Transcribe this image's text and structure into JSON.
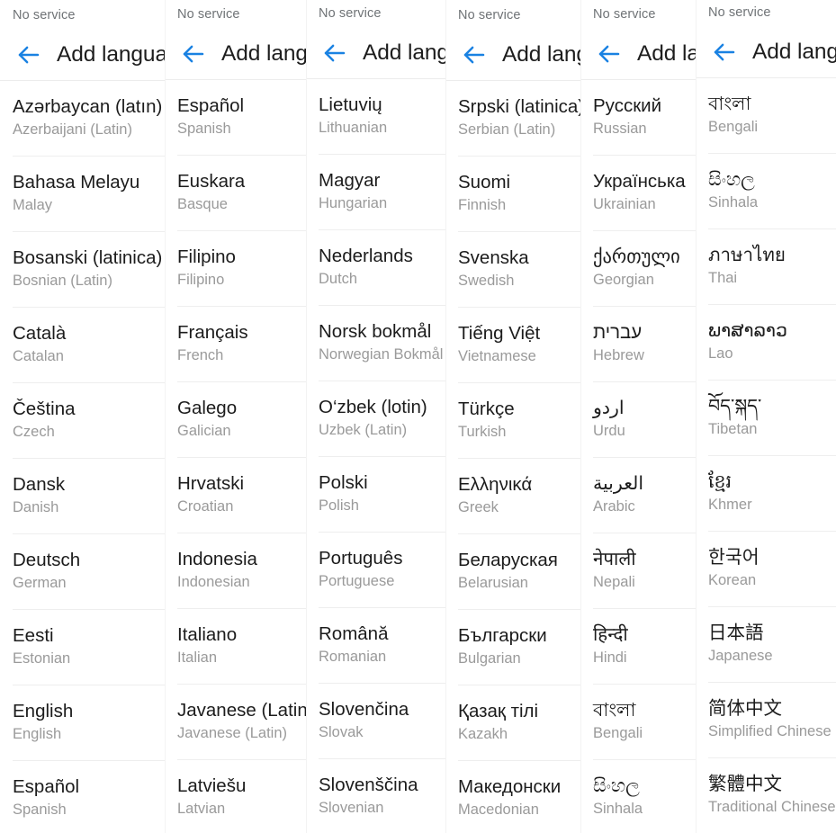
{
  "screen": {
    "status_text": "No service",
    "app_title": "Add language",
    "back_icon": "back-arrow-icon",
    "accent_color": "#1a82e2",
    "title_color": "#1d1d1d",
    "native_color": "#1c1c1c",
    "english_color": "#9a9a9a",
    "divider_color": "#eeeeee",
    "background_color": "#ffffff"
  },
  "panels": [
    {
      "index": 1,
      "status_text": "No service",
      "title": "Add language",
      "title_visible": "Add langua",
      "languages": [
        {
          "native": "Azərbaycan (latın)",
          "english": "Azerbaijani (Latin)"
        },
        {
          "native": "Bahasa Melayu",
          "english": "Malay"
        },
        {
          "native": "Bosanski (latinica)",
          "english": "Bosnian (Latin)"
        },
        {
          "native": "Català",
          "english": "Catalan"
        },
        {
          "native": "Čeština",
          "english": "Czech"
        },
        {
          "native": "Dansk",
          "english": "Danish"
        },
        {
          "native": "Deutsch",
          "english": "German"
        },
        {
          "native": "Eesti",
          "english": "Estonian"
        },
        {
          "native": "English",
          "english": "English"
        },
        {
          "native": "Español",
          "english": "Spanish"
        }
      ]
    },
    {
      "index": 2,
      "status_text": "No service",
      "title": "Add language",
      "title_visible": "Add langu",
      "languages": [
        {
          "native": "Español",
          "english": "Spanish"
        },
        {
          "native": "Euskara",
          "english": "Basque"
        },
        {
          "native": "Filipino",
          "english": "Filipino"
        },
        {
          "native": "Français",
          "english": "French"
        },
        {
          "native": "Galego",
          "english": "Galician"
        },
        {
          "native": "Hrvatski",
          "english": "Croatian"
        },
        {
          "native": "Indonesia",
          "english": "Indonesian"
        },
        {
          "native": "Italiano",
          "english": "Italian"
        },
        {
          "native": "Javanese (Latin)",
          "english": "Javanese (Latin)"
        },
        {
          "native": "Latviešu",
          "english": "Latvian"
        }
      ]
    },
    {
      "index": 3,
      "status_text": "No service",
      "title": "Add language",
      "title_visible": "Add langu",
      "languages": [
        {
          "native": "Lietuvių",
          "english": "Lithuanian"
        },
        {
          "native": "Magyar",
          "english": "Hungarian"
        },
        {
          "native": "Nederlands",
          "english": "Dutch"
        },
        {
          "native": "Norsk bokmål",
          "english": "Norwegian Bokmål"
        },
        {
          "native": "O‘zbek (lotin)",
          "english": "Uzbek (Latin)"
        },
        {
          "native": "Polski",
          "english": "Polish"
        },
        {
          "native": "Português",
          "english": "Portuguese"
        },
        {
          "native": "Română",
          "english": "Romanian"
        },
        {
          "native": "Slovenčina",
          "english": "Slovak"
        },
        {
          "native": "Slovenščina",
          "english": "Slovenian"
        }
      ]
    },
    {
      "index": 4,
      "status_text": "No service",
      "title": "Add language",
      "title_visible": "Add lang",
      "languages": [
        {
          "native": "Srpski (latinica)",
          "english": "Serbian (Latin)"
        },
        {
          "native": "Suomi",
          "english": "Finnish"
        },
        {
          "native": "Svenska",
          "english": "Swedish"
        },
        {
          "native": "Tiếng Việt",
          "english": "Vietnamese"
        },
        {
          "native": "Türkçe",
          "english": "Turkish"
        },
        {
          "native": "Ελληνικά",
          "english": "Greek"
        },
        {
          "native": "Беларуская",
          "english": "Belarusian"
        },
        {
          "native": "Български",
          "english": "Bulgarian"
        },
        {
          "native": "Қазақ тілі",
          "english": "Kazakh"
        },
        {
          "native": "Македонски",
          "english": "Macedonian"
        }
      ]
    },
    {
      "index": 5,
      "status_text": "No service",
      "title": "Add language",
      "title_visible": "Add la",
      "languages": [
        {
          "native": "Русский",
          "english": "Russian"
        },
        {
          "native": "Українська",
          "english": "Ukrainian"
        },
        {
          "native": "ქართული",
          "english": "Georgian"
        },
        {
          "native": "עברית",
          "english": "Hebrew"
        },
        {
          "native": "اردو",
          "english": "Urdu"
        },
        {
          "native": "العربية",
          "english": "Arabic"
        },
        {
          "native": "नेपाली",
          "english": "Nepali"
        },
        {
          "native": "हिन्दी",
          "english": "Hindi"
        },
        {
          "native": "বাংলা",
          "english": "Bengali"
        },
        {
          "native": "සිංහල",
          "english": "Sinhala"
        }
      ]
    },
    {
      "index": 6,
      "status_text": "No service",
      "title": "Add language",
      "title_visible": "Add langu",
      "languages": [
        {
          "native": "বাংলা",
          "english": "Bengali"
        },
        {
          "native": "සිංහල",
          "english": "Sinhala"
        },
        {
          "native": "ภาษาไทย",
          "english": "Thai"
        },
        {
          "native": "ພາສາລາວ",
          "english": "Lao"
        },
        {
          "native": "བོད་སྐད་",
          "english": "Tibetan"
        },
        {
          "native": "ខ្មែរ",
          "english": "Khmer"
        },
        {
          "native": "한국어",
          "english": "Korean"
        },
        {
          "native": "日本語",
          "english": "Japanese"
        },
        {
          "native": "简体中文",
          "english": "Simplified Chinese"
        },
        {
          "native": "繁體中文",
          "english": "Traditional Chinese"
        }
      ]
    }
  ]
}
